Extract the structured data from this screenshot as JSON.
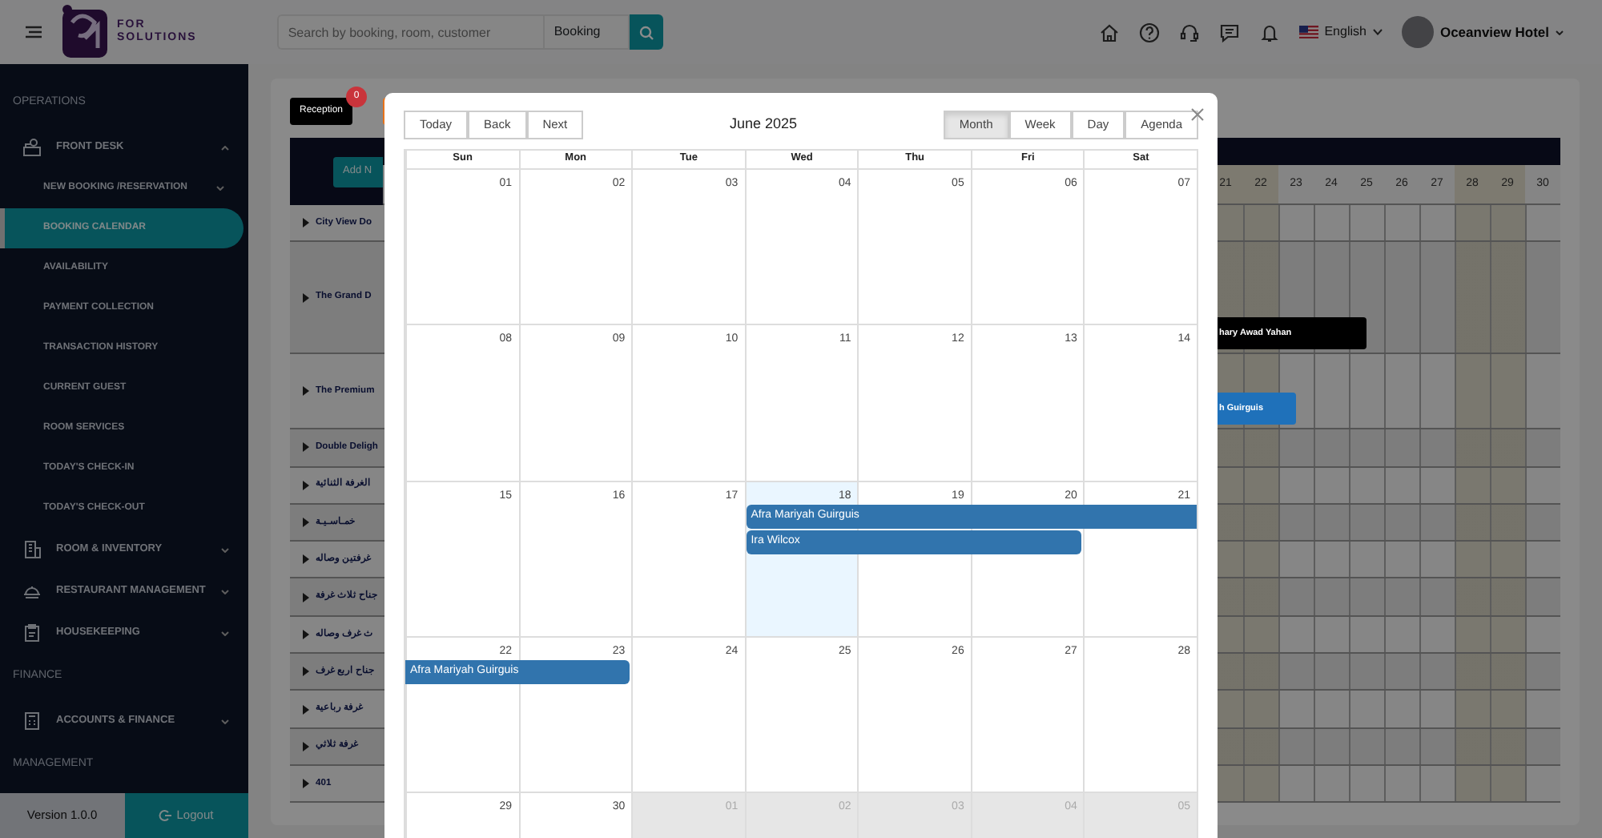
{
  "header": {
    "brand_lines": [
      "FOR",
      "SOLUTIONS"
    ],
    "search": {
      "placeholder": "Search by booking, room, customer"
    },
    "search_scope": "Booking",
    "language": "English",
    "user": "Oceanview Hotel"
  },
  "sidebar": {
    "sections": [
      {
        "heading": "OPERATIONS",
        "items": [
          {
            "label": "FRONT DESK",
            "expanded": true,
            "children": [
              {
                "label": "NEW BOOKING /RESERVATION",
                "kind": "submenu",
                "selected": false
              },
              {
                "label": "BOOKING CALENDAR",
                "kind": "link",
                "selected": true
              },
              {
                "label": "AVAILABILITY",
                "kind": "link",
                "selected": false
              },
              {
                "label": "PAYMENT COLLECTION",
                "kind": "link",
                "selected": false
              },
              {
                "label": "TRANSACTION HISTORY",
                "kind": "link",
                "selected": false
              },
              {
                "label": "CURRENT GUEST",
                "kind": "link",
                "selected": false
              },
              {
                "label": "ROOM SERVICES",
                "kind": "link",
                "selected": false
              },
              {
                "label": "TODAY'S CHECK-IN",
                "kind": "link",
                "selected": false
              },
              {
                "label": "TODAY'S CHECK-OUT",
                "kind": "link",
                "selected": false
              }
            ]
          },
          {
            "label": "ROOM & INVENTORY",
            "expanded": false
          },
          {
            "label": "RESTAURANT MANAGEMENT",
            "expanded": false
          },
          {
            "label": "HOUSEKEEPING",
            "expanded": false
          }
        ]
      },
      {
        "heading": "FINANCE",
        "items": [
          {
            "label": "ACCOUNTS & FINANCE",
            "expanded": false
          }
        ]
      },
      {
        "heading": "MANAGEMENT"
      }
    ],
    "version": "Version 1.0.0",
    "logout": "Logout"
  },
  "schedule": {
    "tabs": [
      {
        "label": "Reception",
        "badge": "0",
        "color": "#000000"
      },
      {
        "color": "#e8731a"
      }
    ],
    "add_button": "Add N",
    "days": [
      {
        "label": "21",
        "weekend": true
      },
      {
        "label": "22",
        "weekend": true
      },
      {
        "label": "23",
        "weekend": false
      },
      {
        "label": "24",
        "weekend": false
      },
      {
        "label": "25",
        "weekend": false
      },
      {
        "label": "26",
        "weekend": false
      },
      {
        "label": "27",
        "weekend": false
      },
      {
        "label": "28",
        "weekend": true
      },
      {
        "label": "29",
        "weekend": true
      },
      {
        "label": "30",
        "weekend": false
      }
    ],
    "rooms": [
      {
        "name": "City View Do"
      },
      {
        "name": "The Grand D",
        "bookings": [
          {
            "guest": "hary Awad Yahan",
            "color": "#000000"
          }
        ]
      },
      {
        "name": "The Premium",
        "bookings": [
          {
            "guest": "h Guirguis",
            "color": "#1f71ba"
          }
        ]
      },
      {
        "name": "Double Deligh"
      },
      {
        "name": "الغرفة الثنائية"
      },
      {
        "name": "خمـاسـيـة"
      },
      {
        "name": "غرفتين وصاله"
      },
      {
        "name": "جناح ثلاث غرفة"
      },
      {
        "name": "ث غرف وصاله"
      },
      {
        "name": "جناح اربع غرف"
      },
      {
        "name": "غرفة رباعية"
      },
      {
        "name": "غرفة ثلاثي"
      },
      {
        "name": "401"
      }
    ]
  },
  "calendar": {
    "nav_buttons": [
      "Today",
      "Back",
      "Next"
    ],
    "title": "June 2025",
    "views": [
      {
        "label": "Month",
        "selected": true
      },
      {
        "label": "Week",
        "selected": false
      },
      {
        "label": "Day",
        "selected": false
      },
      {
        "label": "Agenda",
        "selected": false
      }
    ],
    "weekdays": [
      "Sun",
      "Mon",
      "Tue",
      "Wed",
      "Thu",
      "Fri",
      "Sat"
    ],
    "weeks": [
      {
        "days": [
          {
            "date": "01",
            "today": false,
            "off_range": false
          },
          {
            "date": "02",
            "today": false,
            "off_range": false
          },
          {
            "date": "03",
            "today": false,
            "off_range": false
          },
          {
            "date": "04",
            "today": false,
            "off_range": false
          },
          {
            "date": "05",
            "today": false,
            "off_range": false
          },
          {
            "date": "06",
            "today": false,
            "off_range": false
          },
          {
            "date": "07",
            "today": false,
            "off_range": false
          }
        ]
      },
      {
        "days": [
          {
            "date": "08",
            "today": false,
            "off_range": false
          },
          {
            "date": "09",
            "today": false,
            "off_range": false
          },
          {
            "date": "10",
            "today": false,
            "off_range": false
          },
          {
            "date": "11",
            "today": false,
            "off_range": false
          },
          {
            "date": "12",
            "today": false,
            "off_range": false
          },
          {
            "date": "13",
            "today": false,
            "off_range": false
          },
          {
            "date": "14",
            "today": false,
            "off_range": false
          }
        ]
      },
      {
        "days": [
          {
            "date": "15",
            "today": false,
            "off_range": false
          },
          {
            "date": "16",
            "today": false,
            "off_range": false
          },
          {
            "date": "17",
            "today": false,
            "off_range": false
          },
          {
            "date": "18",
            "today": true,
            "off_range": false
          },
          {
            "date": "19",
            "today": false,
            "off_range": false
          },
          {
            "date": "20",
            "today": false,
            "off_range": false
          },
          {
            "date": "21",
            "today": false,
            "off_range": false
          }
        ],
        "events": [
          {
            "title": "Afra Mariyah Guirguis"
          },
          {
            "title": "Ira Wilcox"
          }
        ]
      },
      {
        "days": [
          {
            "date": "22",
            "today": false,
            "off_range": false
          },
          {
            "date": "23",
            "today": false,
            "off_range": false
          },
          {
            "date": "24",
            "today": false,
            "off_range": false
          },
          {
            "date": "25",
            "today": false,
            "off_range": false
          },
          {
            "date": "26",
            "today": false,
            "off_range": false
          },
          {
            "date": "27",
            "today": false,
            "off_range": false
          },
          {
            "date": "28",
            "today": false,
            "off_range": false
          }
        ],
        "events": [
          {
            "title": "Afra Mariyah Guirguis"
          }
        ]
      },
      {
        "days": [
          {
            "date": "29",
            "today": false,
            "off_range": false
          },
          {
            "date": "30",
            "today": false,
            "off_range": false
          },
          {
            "date": "01",
            "today": false,
            "off_range": true
          },
          {
            "date": "02",
            "today": false,
            "off_range": true
          },
          {
            "date": "03",
            "today": false,
            "off_range": true
          },
          {
            "date": "04",
            "today": false,
            "off_range": true
          },
          {
            "date": "05",
            "today": false,
            "off_range": true
          }
        ]
      }
    ]
  }
}
